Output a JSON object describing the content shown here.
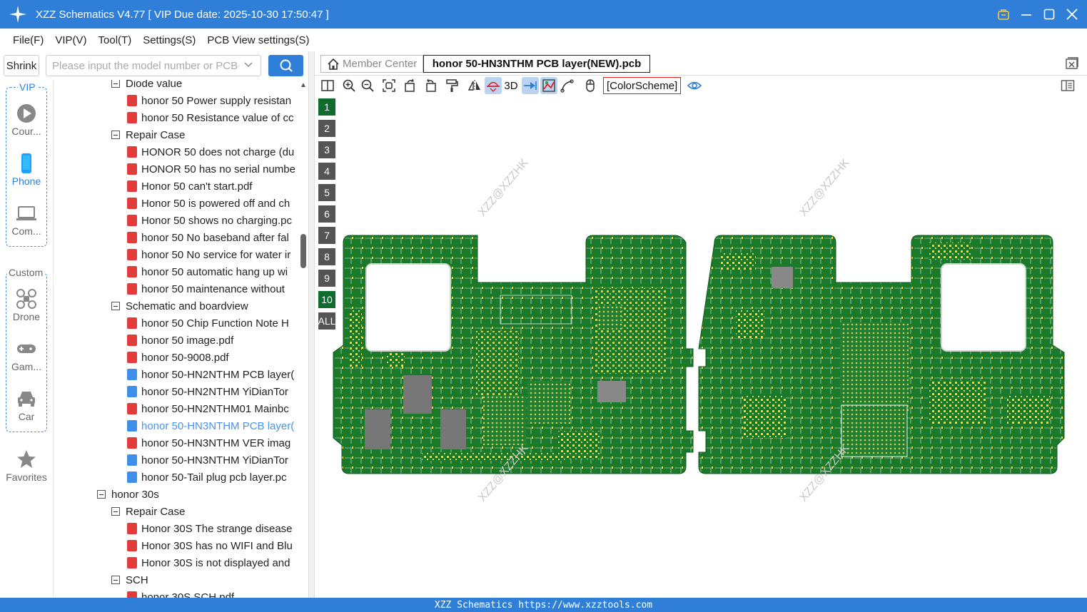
{
  "window": {
    "title": "XZZ Schematics V4.77 [ VIP Due date: 2025-10-30 17:50:47 ]"
  },
  "menu": [
    "File(F)",
    "VIP(V)",
    "Tool(T)",
    "Settings(S)",
    "PCB View settings(S)"
  ],
  "search": {
    "shrink_label": "Shrink",
    "placeholder": "Please input the model number or PCB"
  },
  "categories": {
    "vip_label": "VIP",
    "custom_label": "Custom",
    "items": [
      {
        "label": "Cour...",
        "icon": "play-icon"
      },
      {
        "label": "Phone",
        "icon": "phone-icon"
      },
      {
        "label": "Com...",
        "icon": "laptop-icon"
      },
      {
        "label": "Drone",
        "icon": "drone-icon"
      },
      {
        "label": "Gam...",
        "icon": "gamepad-icon"
      },
      {
        "label": "Car",
        "icon": "car-icon"
      },
      {
        "label": "Favorites",
        "icon": "star-icon"
      }
    ]
  },
  "tree": [
    {
      "label": "Diode value",
      "level": 2,
      "type": "folder"
    },
    {
      "label": "honor 50 Power supply resistan",
      "level": 3,
      "type": "pdf"
    },
    {
      "label": "honor 50 Resistance value of cc",
      "level": 3,
      "type": "pdf"
    },
    {
      "label": "Repair Case",
      "level": 2,
      "type": "folder"
    },
    {
      "label": "HONOR 50 does not charge (du",
      "level": 3,
      "type": "pdf"
    },
    {
      "label": "HONOR 50 has no serial numbe",
      "level": 3,
      "type": "pdf"
    },
    {
      "label": "Honor 50 can't start.pdf",
      "level": 3,
      "type": "pdf"
    },
    {
      "label": "Honor 50 is powered off and ch",
      "level": 3,
      "type": "pdf"
    },
    {
      "label": "Honor 50 shows no charging.pc",
      "level": 3,
      "type": "pdf"
    },
    {
      "label": "honor 50 No baseband after fal",
      "level": 3,
      "type": "pdf"
    },
    {
      "label": "honor 50 No service for water ir",
      "level": 3,
      "type": "pdf"
    },
    {
      "label": "honor 50 automatic hang up wi",
      "level": 3,
      "type": "pdf"
    },
    {
      "label": "honor 50 maintenance without",
      "level": 3,
      "type": "pdf"
    },
    {
      "label": "Schematic and boardview",
      "level": 2,
      "type": "folder"
    },
    {
      "label": "honor 50 Chip Function Note H",
      "level": 3,
      "type": "pdf"
    },
    {
      "label": "honor 50 image.pdf",
      "level": 3,
      "type": "pdf"
    },
    {
      "label": "honor 50-9008.pdf",
      "level": 3,
      "type": "pdf"
    },
    {
      "label": "honor 50-HN2NTHM PCB layer(",
      "level": 3,
      "type": "pcb"
    },
    {
      "label": "honor 50-HN2NTHM YiDianTor",
      "level": 3,
      "type": "pcb"
    },
    {
      "label": "honor 50-HN2NTHM01 Mainbc",
      "level": 3,
      "type": "pdf"
    },
    {
      "label": "honor 50-HN3NTHM PCB layer(",
      "level": 3,
      "type": "pcb",
      "selected": true
    },
    {
      "label": "honor 50-HN3NTHM VER imag",
      "level": 3,
      "type": "pdf"
    },
    {
      "label": "honor 50-HN3NTHM YiDianTor",
      "level": 3,
      "type": "pcb"
    },
    {
      "label": "honor 50-Tail plug pcb layer.pc",
      "level": 3,
      "type": "pcb"
    },
    {
      "label": "honor 30s",
      "level": 1,
      "type": "folder"
    },
    {
      "label": "Repair Case",
      "level": 2,
      "type": "folder"
    },
    {
      "label": "Honor 30S The strange disease",
      "level": 3,
      "type": "pdf"
    },
    {
      "label": "Honor 30S has no WIFI and Blu",
      "level": 3,
      "type": "pdf"
    },
    {
      "label": "Honor 30S is not displayed and",
      "level": 3,
      "type": "pdf"
    },
    {
      "label": "SCH",
      "level": 2,
      "type": "folder"
    },
    {
      "label": "honor 30S SCH.pdf",
      "level": 3,
      "type": "pdf"
    }
  ],
  "tabs": {
    "member_center": "Member Center",
    "active_file": "honor 50-HN3NTHM PCB layer(NEW).pcb"
  },
  "toolbar": {
    "three_d": "3D",
    "color_scheme": "[ColorScheme]"
  },
  "layers": [
    "1",
    "2",
    "3",
    "4",
    "5",
    "6",
    "7",
    "8",
    "9",
    "10",
    "ALL"
  ],
  "watermark": "XZZ@XZZHK",
  "status": "XZZ Schematics https://www.xzztools.com",
  "colors": {
    "accent": "#2f7fd9",
    "pcb_green": "#1a7a2a",
    "pad_yellow": "#e8d84a",
    "layer_active": "#0f6b2e"
  }
}
